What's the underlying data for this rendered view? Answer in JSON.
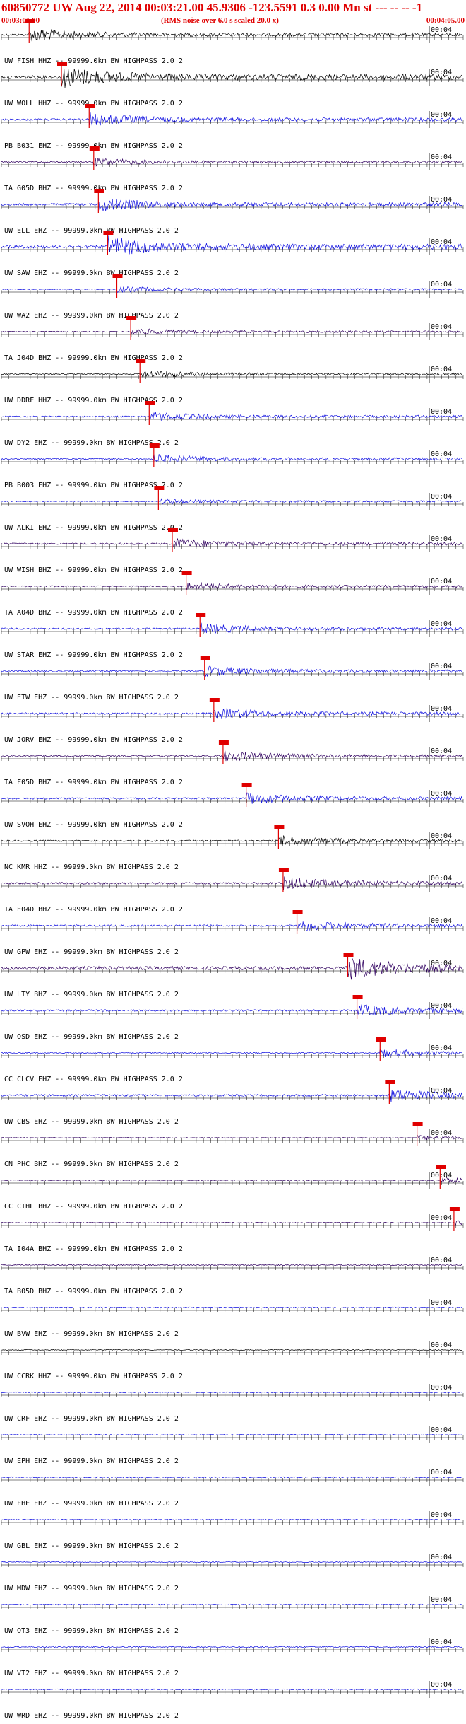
{
  "header": {
    "title": "60850772 UW Aug 22, 2014 00:03:21.00   45.9306 -123.5591  0.3 0.00 Mn st --- -- --   -1",
    "time_start": "00:03:01.00",
    "noise_note": "(RMS noise over 6.0 s scaled 20.0 x)",
    "time_end": "00:04:05.00"
  },
  "colors": {
    "accent": "#e00000",
    "blue": "#1010e0",
    "black": "#000000",
    "purple": "#300060",
    "pick": "#e00000"
  },
  "minute_mark": "00:04",
  "traces": [
    {
      "station": "UW FISH HHZ -- 99999.0km BW  HIGHPASS  2.0  2",
      "color": "black",
      "pick": 0.06,
      "amp": 0.55
    },
    {
      "station": "UW WOLL HHZ -- 99999.0km BW  HIGHPASS  2.0  2",
      "color": "black",
      "pick": 0.13,
      "amp": 0.9
    },
    {
      "station": "PB B031 EHZ -- 99999.0km BW  HIGHPASS  2.0  2",
      "color": "blue",
      "pick": 0.19,
      "amp": 0.55
    },
    {
      "station": "TA G05D BHZ -- 99999.0km BW  HIGHPASS  2.0  2",
      "color": "purple",
      "pick": 0.2,
      "amp": 0.35
    },
    {
      "station": "UW ELL EHZ -- 99999.0km BW  HIGHPASS  2.0  2",
      "color": "blue",
      "pick": 0.21,
      "amp": 0.6
    },
    {
      "station": "UW SAW EHZ -- 99999.0km BW  HIGHPASS  2.0  2",
      "color": "blue",
      "pick": 0.23,
      "amp": 0.85
    },
    {
      "station": "UW WA2 EHZ -- 99999.0km BW  HIGHPASS  2.0  2",
      "color": "blue",
      "pick": 0.25,
      "amp": 0.25
    },
    {
      "station": "TA J04D BHZ -- 99999.0km BW  HIGHPASS  2.0  2",
      "color": "purple",
      "pick": 0.28,
      "amp": 0.3
    },
    {
      "station": "UW DDRF HHZ -- 99999.0km BW  HIGHPASS  2.0  2",
      "color": "black",
      "pick": 0.3,
      "amp": 0.35
    },
    {
      "station": "UW DY2 EHZ -- 99999.0km BW  HIGHPASS  2.0  2",
      "color": "blue",
      "pick": 0.32,
      "amp": 0.4
    },
    {
      "station": "PB B003 EHZ -- 99999.0km BW  HIGHPASS  2.0  2",
      "color": "blue",
      "pick": 0.33,
      "amp": 0.4
    },
    {
      "station": "UW ALKI EHZ -- 99999.0km BW  HIGHPASS  2.0  2",
      "color": "blue",
      "pick": 0.34,
      "amp": 0.25
    },
    {
      "station": "UW WISH BHZ -- 99999.0km BW  HIGHPASS  2.0  2",
      "color": "purple",
      "pick": 0.37,
      "amp": 0.45
    },
    {
      "station": "TA A04D BHZ -- 99999.0km BW  HIGHPASS  2.0  2",
      "color": "purple",
      "pick": 0.4,
      "amp": 0.35
    },
    {
      "station": "UW STAR EHZ -- 99999.0km BW  HIGHPASS  2.0  2",
      "color": "blue",
      "pick": 0.43,
      "amp": 0.45
    },
    {
      "station": "UW ETW EHZ -- 99999.0km BW  HIGHPASS  2.0  2",
      "color": "blue",
      "pick": 0.44,
      "amp": 0.45
    },
    {
      "station": "UW JORV EHZ -- 99999.0km BW  HIGHPASS  2.0  2",
      "color": "blue",
      "pick": 0.46,
      "amp": 0.5
    },
    {
      "station": "TA F05D BHZ -- 99999.0km BW  HIGHPASS  2.0  2",
      "color": "purple",
      "pick": 0.48,
      "amp": 0.45
    },
    {
      "station": "UW SVOH EHZ -- 99999.0km BW  HIGHPASS  2.0  2",
      "color": "blue",
      "pick": 0.53,
      "amp": 0.5
    },
    {
      "station": "NC KMR HHZ -- 99999.0km BW  HIGHPASS  2.0  2",
      "color": "black",
      "pick": 0.6,
      "amp": 0.45
    },
    {
      "station": "TA E04D BHZ -- 99999.0km BW  HIGHPASS  2.0  2",
      "color": "purple",
      "pick": 0.61,
      "amp": 0.55
    },
    {
      "station": "UW GPW EHZ -- 99999.0km BW  HIGHPASS  2.0  2",
      "color": "blue",
      "pick": 0.64,
      "amp": 0.5
    },
    {
      "station": "UW LTY BHZ -- 99999.0km BW  HIGHPASS  2.0  2",
      "color": "purple",
      "pick": 0.75,
      "amp": 0.95
    },
    {
      "station": "UW OSD EHZ -- 99999.0km BW  HIGHPASS  2.0  2",
      "color": "blue",
      "pick": 0.77,
      "amp": 0.5
    },
    {
      "station": "CC CLCV EHZ -- 99999.0km BW  HIGHPASS  2.0  2",
      "color": "blue",
      "pick": 0.82,
      "amp": 0.35
    },
    {
      "station": "UW CBS EHZ -- 99999.0km BW  HIGHPASS  2.0  2",
      "color": "blue",
      "pick": 0.84,
      "amp": 0.55
    },
    {
      "station": "CN PHC BHZ -- 99999.0km BW  HIGHPASS  2.0  2",
      "color": "purple",
      "pick": 0.9,
      "amp": 0.2
    },
    {
      "station": "CC CIHL BHZ -- 99999.0km BW  HIGHPASS  2.0  2",
      "color": "purple",
      "pick": 0.95,
      "amp": 0.25
    },
    {
      "station": "TA I04A BHZ -- 99999.0km BW  HIGHPASS  2.0  2",
      "color": "purple",
      "pick": 0.98,
      "amp": 0.25
    },
    {
      "station": "TA B05D BHZ -- 99999.0km BW  HIGHPASS  2.0  2",
      "color": "purple",
      "pick": null,
      "amp": 0.35
    },
    {
      "station": "UW BVW EHZ -- 99999.0km BW  HIGHPASS  2.0  2",
      "color": "blue",
      "pick": null,
      "amp": 0.3
    },
    {
      "station": "UW CCRK HHZ -- 99999.0km BW  HIGHPASS  2.0  2",
      "color": "black",
      "pick": null,
      "amp": 0.25
    },
    {
      "station": "UW CRF EHZ -- 99999.0km BW  HIGHPASS  2.0  2",
      "color": "blue",
      "pick": null,
      "amp": 0.3
    },
    {
      "station": "UW EPH EHZ -- 99999.0km BW  HIGHPASS  2.0  2",
      "color": "blue",
      "pick": null,
      "amp": 0.25
    },
    {
      "station": "UW FHE EHZ -- 99999.0km BW  HIGHPASS  2.0  2",
      "color": "blue",
      "pick": null,
      "amp": 0.3
    },
    {
      "station": "UW GBL EHZ -- 99999.0km BW  HIGHPASS  2.0  2",
      "color": "blue",
      "pick": null,
      "amp": 0.25
    },
    {
      "station": "UW MDW EHZ -- 99999.0km BW  HIGHPASS  2.0  2",
      "color": "blue",
      "pick": null,
      "amp": 0.25
    },
    {
      "station": "UW OT3 EHZ -- 99999.0km BW  HIGHPASS  2.0  2",
      "color": "blue",
      "pick": null,
      "amp": 0.3
    },
    {
      "station": "UW VT2 EHZ -- 99999.0km BW  HIGHPASS  2.0  2",
      "color": "blue",
      "pick": null,
      "amp": 0.35
    },
    {
      "station": "UW WRD EHZ -- 99999.0km BW  HIGHPASS  2.0  2",
      "color": "blue",
      "pick": null,
      "amp": 0.3
    }
  ]
}
